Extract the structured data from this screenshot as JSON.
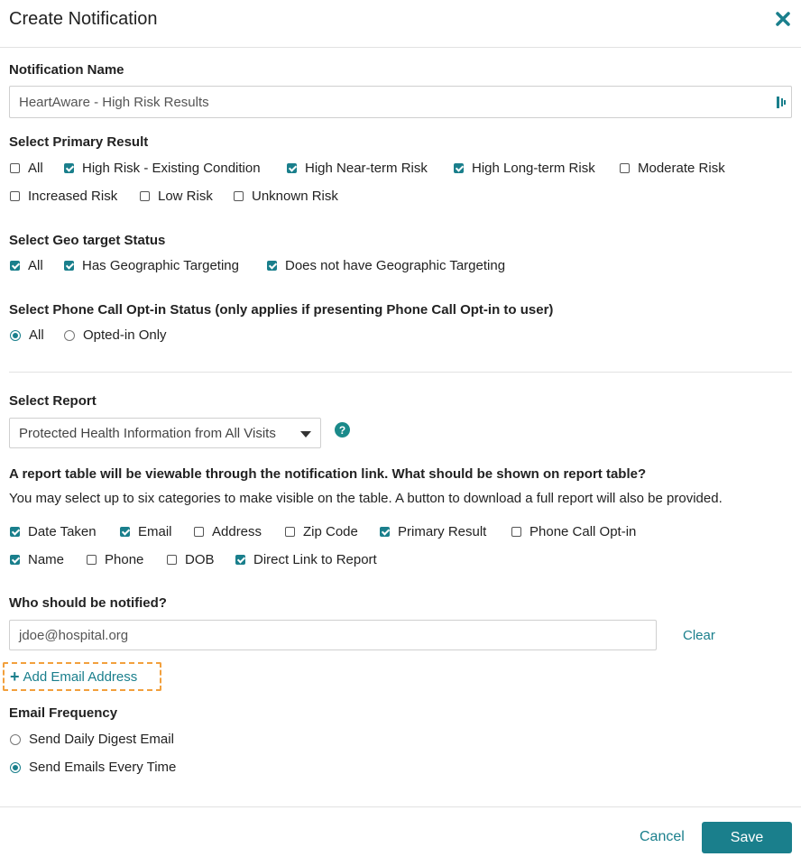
{
  "dialog": {
    "title": "Create Notification",
    "close_icon": "close-icon"
  },
  "notification_name": {
    "label": "Notification Name",
    "value": "HeartAware - High Risk Results"
  },
  "primary_result": {
    "label": "Select Primary Result",
    "options": [
      {
        "label": "All",
        "checked": false
      },
      {
        "label": "High Risk - Existing Condition",
        "checked": true
      },
      {
        "label": "High Near-term Risk",
        "checked": true
      },
      {
        "label": "High Long-term Risk",
        "checked": true
      },
      {
        "label": "Moderate Risk",
        "checked": false
      },
      {
        "label": "Increased Risk",
        "checked": false
      },
      {
        "label": "Low Risk",
        "checked": false
      },
      {
        "label": "Unknown Risk",
        "checked": false
      }
    ]
  },
  "geo_status": {
    "label": "Select Geo target Status",
    "options": [
      {
        "label": "All",
        "checked": true
      },
      {
        "label": "Has Geographic Targeting",
        "checked": true
      },
      {
        "label": "Does not have Geographic Targeting",
        "checked": true
      }
    ]
  },
  "phone_optin": {
    "label": "Select Phone Call Opt-in Status (only applies if presenting Phone Call Opt-in to user)",
    "options": [
      {
        "label": "All",
        "selected": true
      },
      {
        "label": "Opted-in Only",
        "selected": false
      }
    ]
  },
  "report": {
    "label": "Select Report",
    "selected": "Protected Health Information from All Visits"
  },
  "report_table": {
    "heading": "A report table will be viewable through the notification link. What should be shown on report table?",
    "description": "You may select up to six categories to make visible on the table. A button to download a full report will also be provided.",
    "options": [
      {
        "label": "Date Taken",
        "checked": true
      },
      {
        "label": "Email",
        "checked": true
      },
      {
        "label": "Address",
        "checked": false
      },
      {
        "label": "Zip Code",
        "checked": false
      },
      {
        "label": "Primary Result",
        "checked": true
      },
      {
        "label": "Phone Call Opt-in",
        "checked": false
      },
      {
        "label": "Name",
        "checked": true
      },
      {
        "label": "Phone",
        "checked": false
      },
      {
        "label": "DOB",
        "checked": false
      },
      {
        "label": "Direct Link to Report",
        "checked": true
      }
    ]
  },
  "notify": {
    "label": "Who should be notified?",
    "email_value": "jdoe@hospital.org",
    "clear_label": "Clear",
    "add_label": "Add Email Address"
  },
  "frequency": {
    "label": "Email Frequency",
    "options": [
      {
        "label": "Send Daily Digest Email",
        "selected": false
      },
      {
        "label": "Send Emails Every Time",
        "selected": true
      }
    ]
  },
  "footer": {
    "cancel_label": "Cancel",
    "save_label": "Save"
  },
  "colors": {
    "accent": "#1a7f8c",
    "highlight_border": "#f2a03d"
  }
}
